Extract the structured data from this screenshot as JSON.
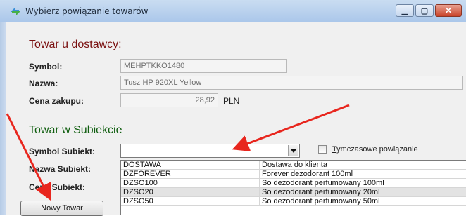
{
  "window": {
    "title": "Wybierz powiązanie towarów",
    "minimize_glyph": "▁",
    "maximize_glyph": "▢",
    "close_glyph": "✕",
    "icon": "app-arrows-icon"
  },
  "supplier_section": {
    "heading": "Towar u dostawcy:",
    "symbol_label": "Symbol:",
    "symbol_value": "MEHPTKKO1480",
    "name_label": "Nazwa:",
    "name_value": "Tusz HP 920XL Yellow",
    "price_label": "Cena zakupu:",
    "price_value": "28,92",
    "currency": "PLN"
  },
  "subiekt_section": {
    "heading": "Towar w Subiekcie",
    "symbol_label": "Symbol Subiekt:",
    "symbol_value": "",
    "name_label": "Nazwa Subiekt:",
    "price_label": "Cena Subiekt:",
    "temp_link_label_first": "T",
    "temp_link_label_rest": "ymczasowe powiązanie",
    "temp_link_checked": false,
    "new_item_button": "Nowy Towar"
  },
  "dropdown_rows": [
    {
      "code": "DOSTAWA",
      "name": "Dostawa do klienta",
      "selected": false
    },
    {
      "code": "DZFOREVER",
      "name": "Forever dezodorant 100ml",
      "selected": false
    },
    {
      "code": "DZSO100",
      "name": "So dezodorant perfumowany 100ml",
      "selected": false
    },
    {
      "code": "DZSO20",
      "name": "So dezodorant perfumowany 20ml",
      "selected": true
    },
    {
      "code": "DZSO50",
      "name": "So dezodorant perfumowany 50ml",
      "selected": false
    }
  ],
  "colors": {
    "section_red": "#7a1010",
    "section_green": "#0e5d0e",
    "annotation_arrow": "#e8261e"
  }
}
